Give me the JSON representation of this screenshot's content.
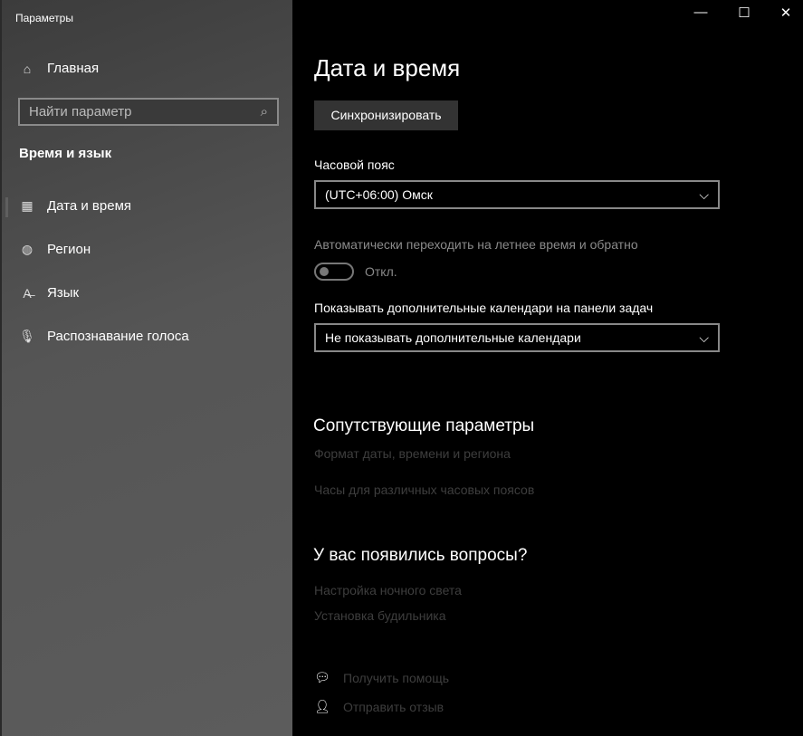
{
  "window": {
    "title": "Параметры",
    "minimize": "—",
    "maximize": "☐",
    "close": "✕"
  },
  "sidebar": {
    "home": "Главная",
    "search_placeholder": "Найти параметр",
    "section": "Время и язык",
    "items": [
      {
        "label": "Дата и время",
        "icon": "calendar-clock-icon",
        "selected": true
      },
      {
        "label": "Регион",
        "icon": "globe-icon"
      },
      {
        "label": "Язык",
        "icon": "language-icon"
      },
      {
        "label": "Распознавание голоса",
        "icon": "microphone-icon"
      }
    ]
  },
  "main": {
    "title": "Дата и время",
    "sync_button": "Синхронизировать",
    "timezone_label": "Часовой пояс",
    "timezone_value": "(UTC+06:00) Омск",
    "dst_label": "Автоматически переходить на летнее время и обратно",
    "dst_state": "Откл.",
    "calendars_label": "Показывать дополнительные календари на панели задач",
    "calendars_value": "Не показывать дополнительные календари",
    "related_heading": "Сопутствующие параметры",
    "related_links": [
      "Формат даты, времени и региона",
      "Часы для различных часовых поясов"
    ],
    "questions_heading": "У вас появились вопросы?",
    "question_links": [
      "Настройка ночного света",
      "Установка будильника"
    ],
    "get_help": "Получить помощь",
    "feedback": "Отправить отзыв"
  }
}
